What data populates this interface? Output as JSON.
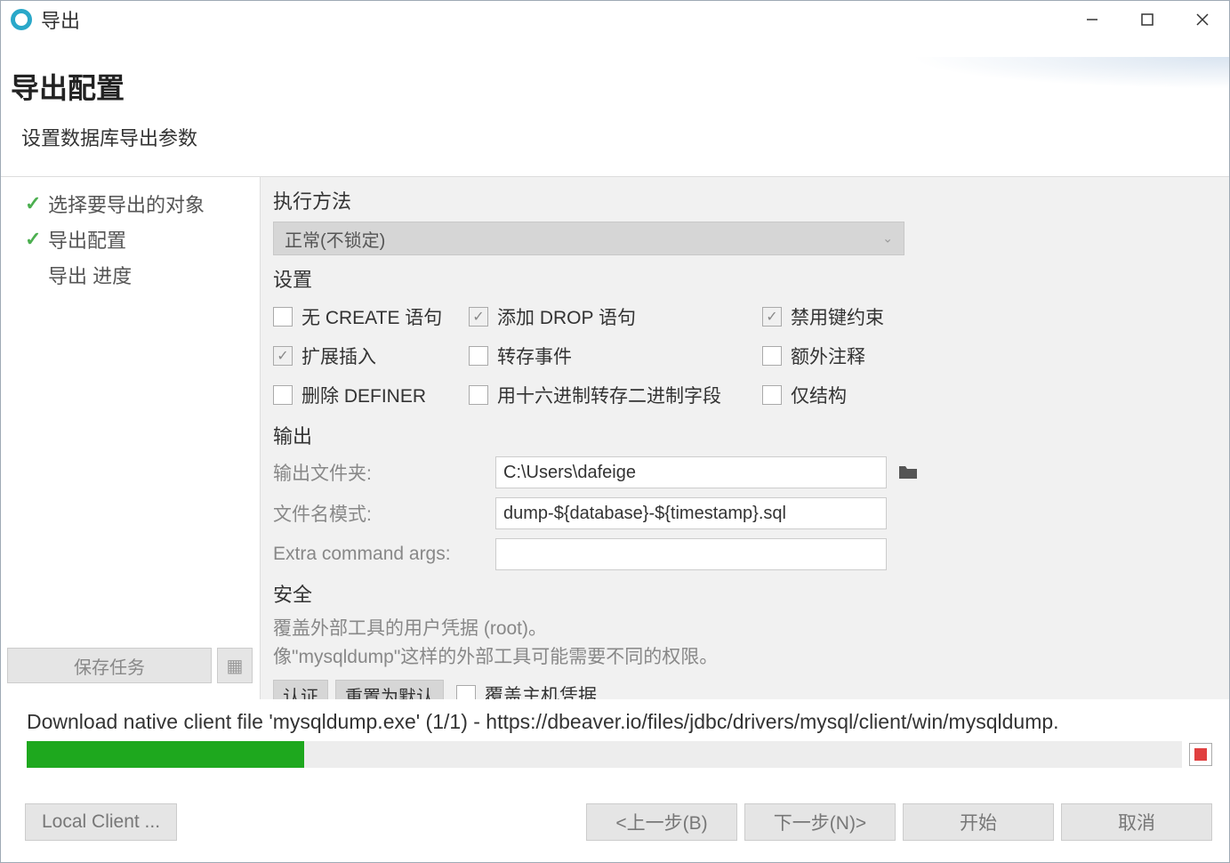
{
  "titlebar": {
    "title": "导出"
  },
  "header": {
    "title": "导出配置",
    "subtitle": "设置数据库导出参数"
  },
  "sidebar": {
    "items": [
      {
        "label": "选择要导出的对象",
        "checked": true
      },
      {
        "label": "导出配置",
        "checked": true
      },
      {
        "label": "导出 进度",
        "checked": false
      }
    ],
    "save_task_label": "保存任务"
  },
  "main": {
    "exec_method": {
      "title": "执行方法",
      "selected": "正常(不锁定)"
    },
    "settings": {
      "title": "设置",
      "items": [
        {
          "label": "无 CREATE 语句",
          "checked": false
        },
        {
          "label": "添加 DROP 语句",
          "checked": true
        },
        {
          "label": "禁用键约束",
          "checked": true
        },
        {
          "label": "扩展插入",
          "checked": true
        },
        {
          "label": "转存事件",
          "checked": false
        },
        {
          "label": "额外注释",
          "checked": false
        },
        {
          "label": "删除 DEFINER",
          "checked": false
        },
        {
          "label": "用十六进制转存二进制字段",
          "checked": false
        },
        {
          "label": "仅结构",
          "checked": false
        }
      ]
    },
    "output": {
      "title": "输出",
      "folder_label": "输出文件夹:",
      "folder_value": "C:\\Users\\dafeige",
      "pattern_label": "文件名模式:",
      "pattern_value": "dump-${database}-${timestamp}.sql",
      "extra_args_label": "Extra command args:",
      "extra_args_value": ""
    },
    "security": {
      "title": "安全",
      "desc1": "覆盖外部工具的用户凭据 (root)。",
      "desc2": "像\"mysqldump\"这样的外部工具可能需要不同的权限。",
      "auth_btn": "认证",
      "reset_btn": "重置为默认",
      "override_host_label": "覆盖主机凭据",
      "override_host_checked": false
    }
  },
  "progress": {
    "label": "Download native client file 'mysqldump.exe' (1/1) - https://dbeaver.io/files/jdbc/drivers/mysql/client/win/mysqldump.",
    "percent": 24
  },
  "footer": {
    "local_client": "Local Client ...",
    "back": "<上一步(B)",
    "next": "下一步(N)>",
    "start": "开始",
    "cancel": "取消"
  }
}
